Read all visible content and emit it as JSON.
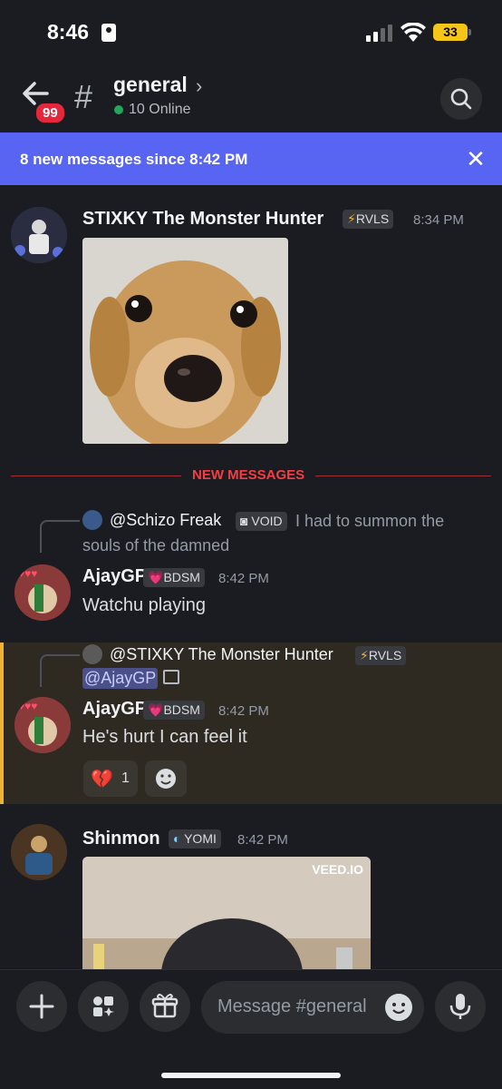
{
  "status": {
    "time": "8:46",
    "battery": "33"
  },
  "header": {
    "badge": "99",
    "channel": "general",
    "online": "10 Online"
  },
  "banner": {
    "text": "8 new messages since 8:42 PM"
  },
  "messages": [
    {
      "author": "STIXKY The Monster Hunter",
      "tag": "RVLS",
      "time": "8:34 PM"
    },
    {
      "divider": "NEW MESSAGES"
    },
    {
      "reply_author": "@Schizo Freak",
      "reply_tag": "VOID",
      "reply_text_1": "I had to summon the",
      "reply_text_2": "souls of the damned",
      "author": "AjayGP",
      "tag": "BDSM",
      "time": "8:42 PM",
      "text": "Watchu playing"
    },
    {
      "reply_author": "@STIXKY The Monster Hunter",
      "reply_tag": "RVLS",
      "reply_mention": "@AjayGP",
      "author": "AjayGP",
      "tag": "BDSM",
      "time": "8:42 PM",
      "text": "He's hurt I can feel it",
      "reaction_count": "1"
    },
    {
      "author": "Shinmon",
      "tag": "YOMI",
      "time": "8:42 PM",
      "watermark": "VEED.IO"
    }
  ],
  "composer": {
    "placeholder": "Message #general"
  },
  "colors": {
    "accent": "#5865f2",
    "new_messages": "#f23f43",
    "highlight_bar": "#f0b232",
    "online": "#23a55a"
  }
}
